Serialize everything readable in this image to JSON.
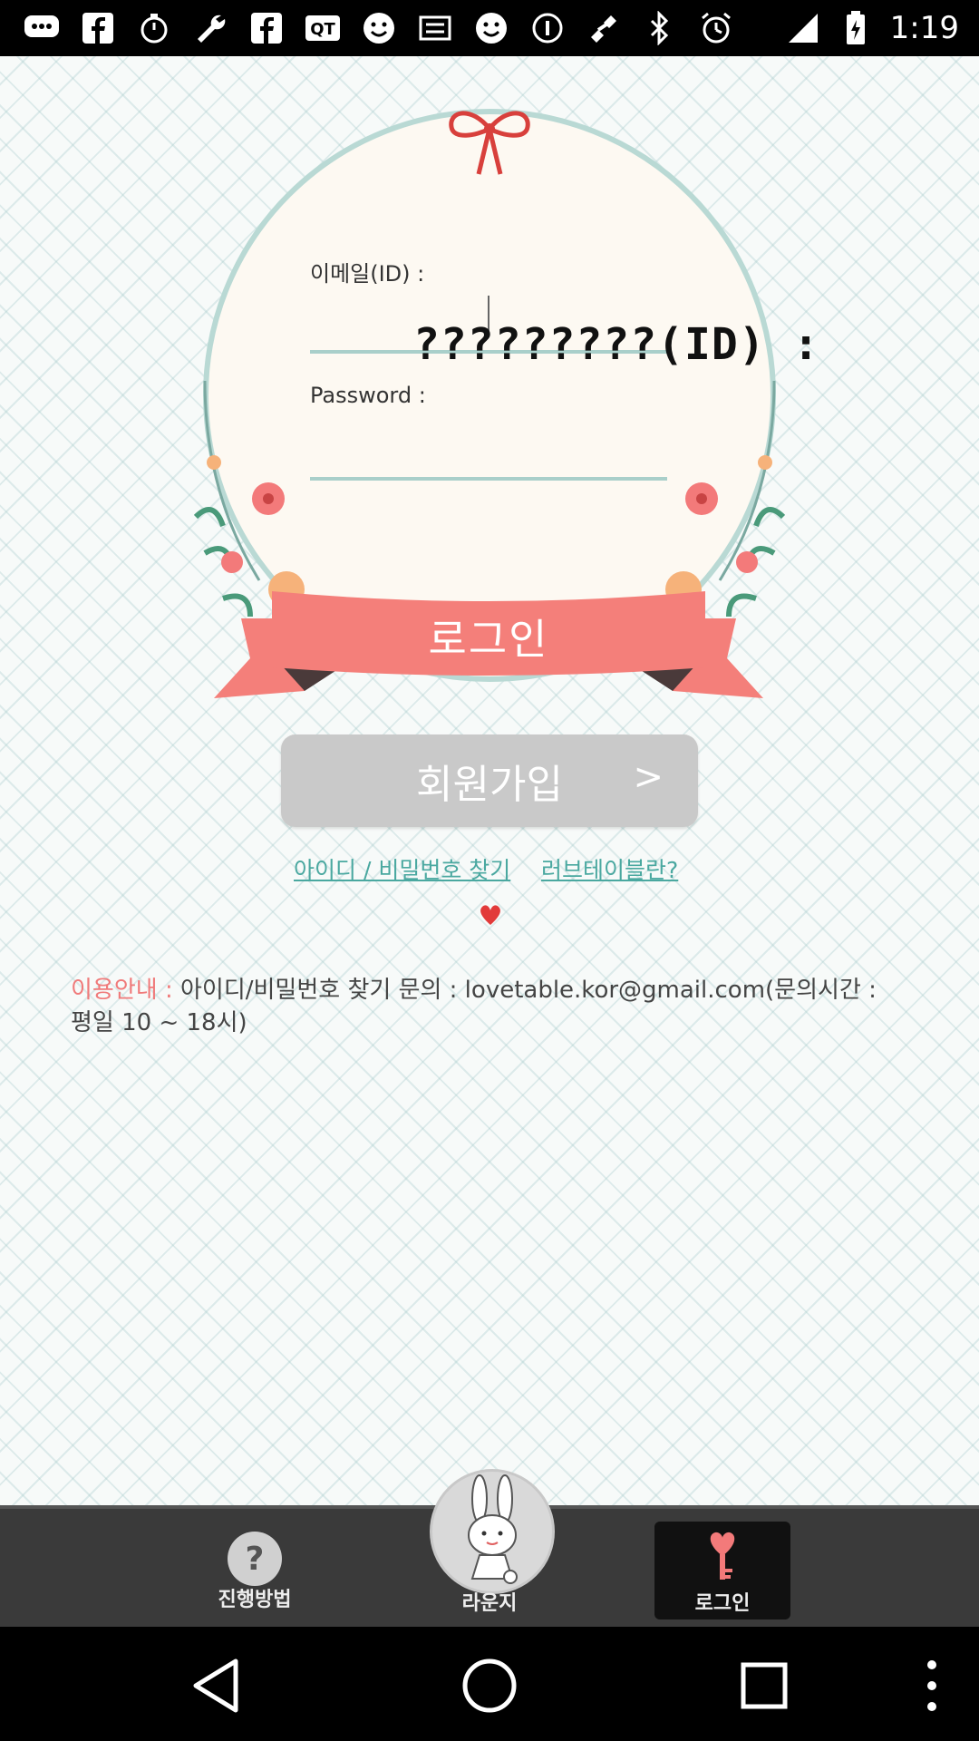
{
  "status_bar": {
    "time": "1:19",
    "icons": [
      "chat-bubble-icon",
      "facebook-icon",
      "stopwatch-icon",
      "wrench-icon",
      "facebook-icon",
      "qt-icon",
      "smiley-icon",
      "taobao-icon",
      "smiley-icon",
      "info-icon",
      "fake-gps-icon",
      "bluetooth-icon",
      "alarm-icon",
      "signal-icon",
      "battery-icon"
    ]
  },
  "login": {
    "email_label": "이메일(ID) :",
    "email_value": "",
    "overlay_text": "?????????(ID) :",
    "password_label": "Password :",
    "password_value": "",
    "login_button": "로그인"
  },
  "signup": {
    "label": "회원가입",
    "chevron": ">"
  },
  "links": {
    "find_account": "아이디 / 비밀번호 찾기",
    "about": "러브테이블란?"
  },
  "notice": {
    "prefix": "이용안내 :",
    "body": " 아이디/비밀번호 찾기 문의 : lovetable.kor@gmail.com(문의시간 : 평일 10 ~ 18시)"
  },
  "tabs": {
    "help": "진행방법",
    "lounge": "라운지",
    "login": "로그인"
  },
  "colors": {
    "accent_red": "#f07a7a",
    "ribbon": "#f47f7a",
    "link_teal": "#4aa8a0",
    "frame_teal": "#b9d9d4"
  }
}
